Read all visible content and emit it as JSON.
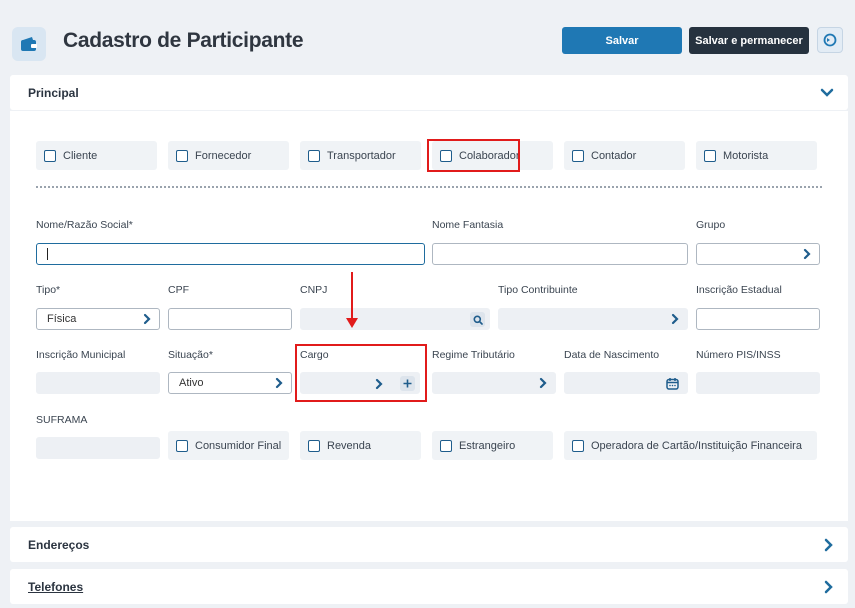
{
  "header": {
    "title": "Cadastro de Participante",
    "save_label": "Salvar",
    "save_stay_label": "Salvar e permanecer"
  },
  "sections": {
    "principal": "Principal",
    "enderecos": "Endereços",
    "telefones": "Telefones"
  },
  "roles": [
    {
      "label": "Cliente",
      "checked": false
    },
    {
      "label": "Fornecedor",
      "checked": false
    },
    {
      "label": "Transportador",
      "checked": false
    },
    {
      "label": "Colaborador",
      "checked": false
    },
    {
      "label": "Contador",
      "checked": false
    },
    {
      "label": "Motorista",
      "checked": false
    }
  ],
  "fields": {
    "nome": {
      "label": "Nome/Razão Social*",
      "value": ""
    },
    "fantasia": {
      "label": "Nome Fantasia",
      "value": ""
    },
    "grupo": {
      "label": "Grupo",
      "value": ""
    },
    "tipo": {
      "label": "Tipo*",
      "value": "Física"
    },
    "cpf": {
      "label": "CPF",
      "value": ""
    },
    "cnpj": {
      "label": "CNPJ",
      "value": ""
    },
    "tipo_contribuinte": {
      "label": "Tipo Contribuinte",
      "value": ""
    },
    "inscricao_estadual": {
      "label": "Inscrição Estadual",
      "value": ""
    },
    "inscricao_municipal": {
      "label": "Inscrição Municipal",
      "value": ""
    },
    "situacao": {
      "label": "Situação*",
      "value": "Ativo"
    },
    "cargo": {
      "label": "Cargo",
      "value": ""
    },
    "regime": {
      "label": "Regime Tributário",
      "value": ""
    },
    "nascimento": {
      "label": "Data de Nascimento",
      "value": ""
    },
    "pis": {
      "label": "Número PIS/INSS",
      "value": ""
    },
    "suframa": {
      "label": "SUFRAMA",
      "value": ""
    }
  },
  "flags": [
    {
      "label": "Consumidor Final",
      "checked": false
    },
    {
      "label": "Revenda",
      "checked": false
    },
    {
      "label": "Estrangeiro",
      "checked": false
    },
    {
      "label": "Operadora de Cartão/Instituição Financeira",
      "checked": false
    }
  ],
  "colors": {
    "primary": "#1f78b4",
    "dark": "#26323f",
    "highlight": "#e11b1b"
  }
}
